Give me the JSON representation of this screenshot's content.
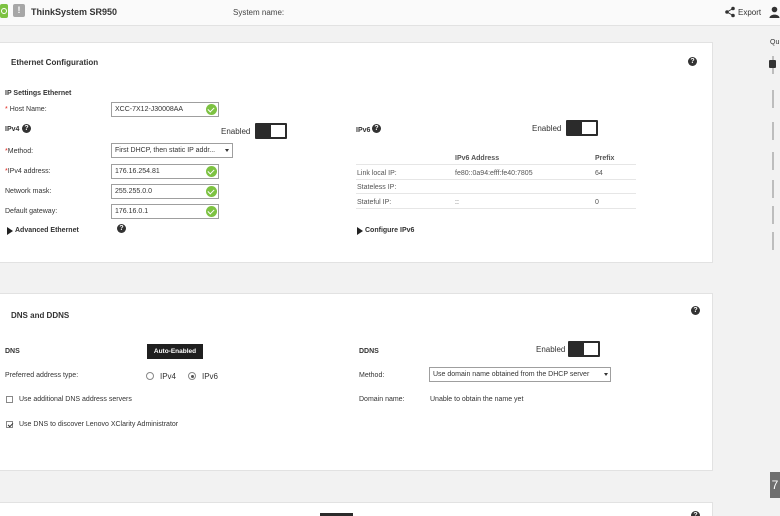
{
  "header": {
    "product": "ThinkSystem SR950",
    "system_name_label": "System name:",
    "export_label": "Export",
    "warn_glyph": "!"
  },
  "right_rail": {
    "label": "Qu",
    "button_glyph": "7"
  },
  "ethernet": {
    "title": "Ethernet Configuration",
    "ip_settings_heading": "IP Settings Ethernet",
    "host_name_label": "Host Name:",
    "host_name_value": "XCC-7X12-J30008AA",
    "ipv4_label": "IPv4",
    "ipv4_enabled_label": "Enabled",
    "method_label": "Method:",
    "method_value": "First DHCP, then static IP addr...",
    "ipv4_address_label": "IPv4 address:",
    "ipv4_address_value": "176.16.254.81",
    "netmask_label": "Network mask:",
    "netmask_value": "255.255.0.0",
    "gateway_label": "Default gateway:",
    "gateway_value": "176.16.0.1",
    "advanced_label": "Advanced Ethernet",
    "ipv6_label": "IPv6",
    "ipv6_enabled_label": "Enabled",
    "ipv6_table": {
      "headers": [
        "IPv6 Address",
        "Prefix"
      ],
      "rows": [
        {
          "label": "Link local IP:",
          "address": "fe80::0a94:efff:fe40:7805",
          "prefix": "64"
        },
        {
          "label": "Stateless IP:",
          "address": "",
          "prefix": ""
        },
        {
          "label": "Stateful IP:",
          "address": "::",
          "prefix": "0"
        }
      ]
    },
    "configure_ipv6_label": "Configure IPv6"
  },
  "dns": {
    "title": "DNS and DDNS",
    "dns_label": "DNS",
    "auto_enabled_label": "Auto-Enabled",
    "preferred_label": "Preferred address type:",
    "pref_options": [
      "IPv4",
      "IPv6"
    ],
    "pref_selected": "IPv6",
    "additional_dns_label": "Use additional DNS address servers",
    "additional_dns_checked": false,
    "xclarity_label": "Use DNS to discover Lenovo XClarity Administrator",
    "xclarity_checked": true,
    "ddns_label": "DDNS",
    "ddns_enabled_label": "Enabled",
    "ddns_method_label": "Method:",
    "ddns_method_value": "Use domain name obtained from the DHCP server",
    "domain_name_label": "Domain name:",
    "domain_name_value": "Unable to obtain the name yet"
  },
  "colors": {
    "accent_green": "#7dc242",
    "toggle_dark": "#2b2b2b",
    "required_red": "#e1251b"
  }
}
